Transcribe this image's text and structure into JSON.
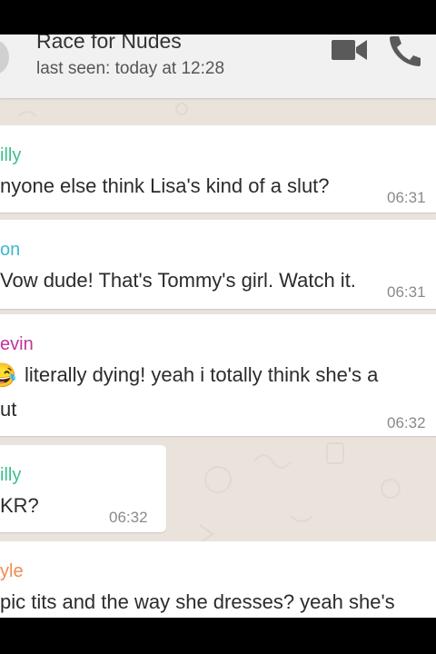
{
  "header": {
    "contact_name": "Race for Nudes",
    "status": "last seen: today at 12:28",
    "icons": [
      "video-call-icon",
      "phone-icon"
    ]
  },
  "messages": [
    {
      "sender": "illy",
      "text": "nyone else think Lisa's kind of a slut?",
      "time": "06:31",
      "sender_color": "#3dbf8e"
    },
    {
      "sender": "on",
      "text": "Vow dude! That's Tommy's girl. Watch it.",
      "time": "06:31",
      "sender_color": "#40b7d4"
    },
    {
      "sender": "evin",
      "text_line1": "literally dying! yeah i totally think she's a",
      "text_line2": "ut",
      "time": "06:32",
      "sender_color": "#c1339b",
      "emoji": "😂"
    },
    {
      "sender": "illy",
      "text": "KR?",
      "time": "06:32",
      "sender_color": "#3dbf8e"
    },
    {
      "sender": "yle",
      "text": "pic tits and the way she dresses? yeah she's",
      "sender_color": "#f08a52"
    }
  ],
  "colors": {
    "chat_background": "#e9e3dc",
    "bubble": "#ffffff",
    "header": "#f1f1f1"
  }
}
